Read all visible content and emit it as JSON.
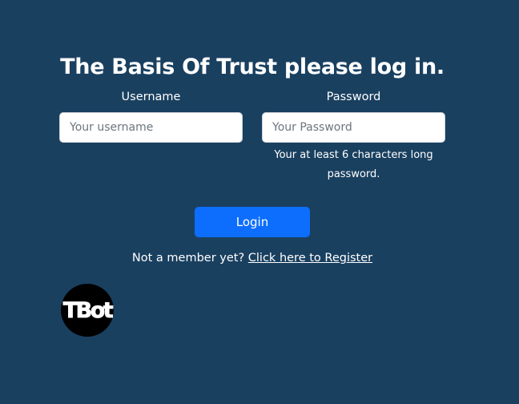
{
  "header": {
    "title": "The Basis Of Trust please log in."
  },
  "form": {
    "username": {
      "label": "Username",
      "placeholder": "Your username",
      "value": ""
    },
    "password": {
      "label": "Password",
      "placeholder": "Your Password",
      "value": "",
      "hint": "Your at least 6 characters long password."
    },
    "login_label": "Login"
  },
  "register": {
    "prompt": "Not a member yet?",
    "link_label": "Click here to Register"
  },
  "logo": {
    "text": "TBot",
    "icon": "tbot-logo"
  },
  "colors": {
    "background": "#1a4060",
    "button": "#0d6efd",
    "text": "#ffffff",
    "logo_bg": "#000000"
  }
}
